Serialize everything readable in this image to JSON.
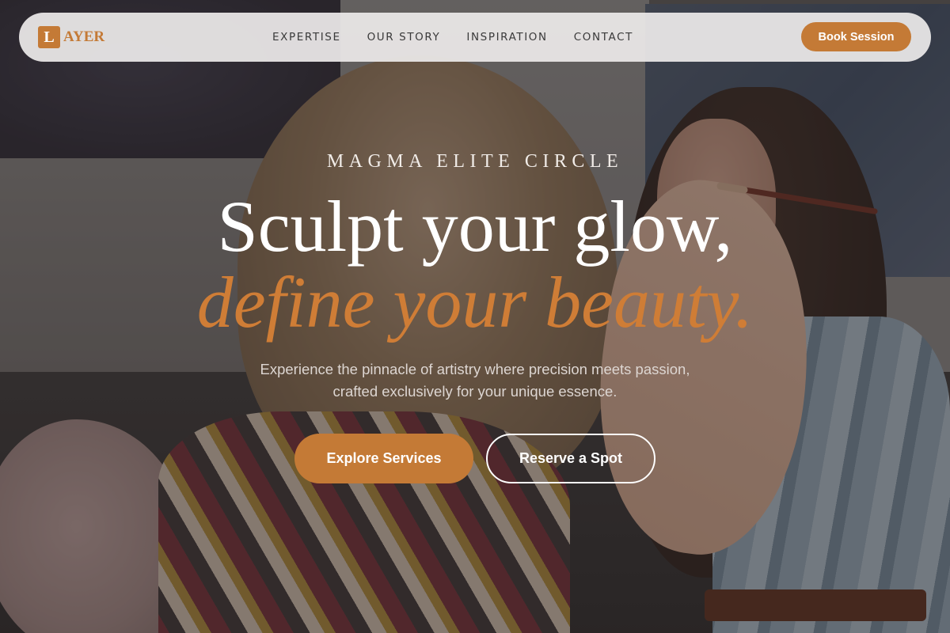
{
  "brand": {
    "logo_mark": "L",
    "logo_text": "AYER",
    "accent_color": "#c47a36"
  },
  "nav": {
    "links": [
      {
        "label": "EXPERTISE"
      },
      {
        "label": "OUR STORY"
      },
      {
        "label": "INSPIRATION"
      },
      {
        "label": "CONTACT"
      }
    ],
    "cta_label": "Book Session"
  },
  "hero": {
    "eyebrow": "MAGMA ELITE CIRCLE",
    "headline_line1": "Sculpt your glow,",
    "headline_line2": "define your beauty.",
    "subtext_line1": "Experience the pinnacle of artistry where precision meets passion,",
    "subtext_line2": "crafted exclusively for your unique essence.",
    "primary_cta": "Explore Services",
    "secondary_cta": "Reserve a Spot",
    "background_image": "makeup-artist-photo"
  }
}
